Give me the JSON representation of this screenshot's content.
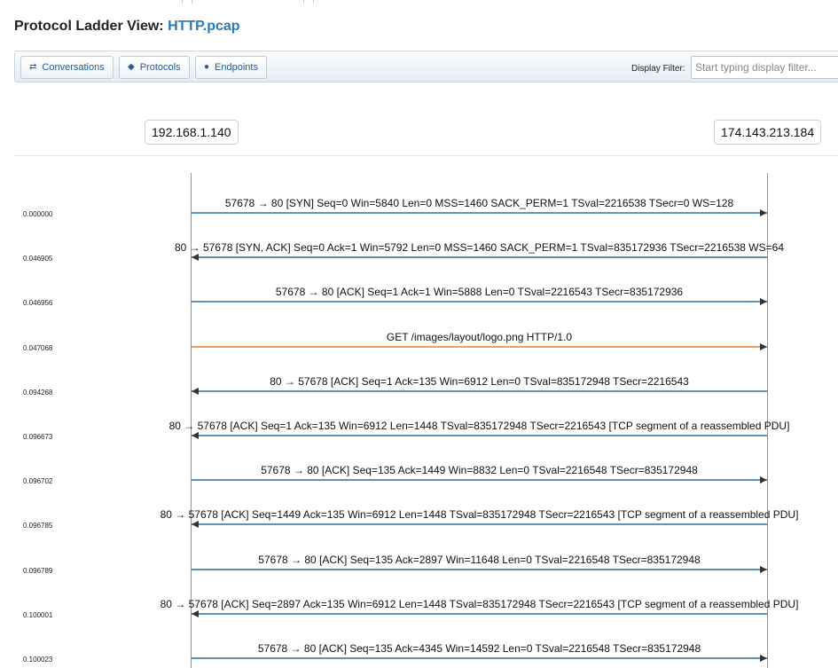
{
  "title": {
    "label": "Protocol Ladder View:",
    "file": "HTTP.pcap"
  },
  "toolbar": {
    "buttons": [
      {
        "icon": "arrows-exchange-icon",
        "glyph": "⇄",
        "label": "Conversations"
      },
      {
        "icon": "tag-icon",
        "glyph": "◆",
        "label": "Protocols"
      },
      {
        "icon": "dot-icon",
        "glyph": "●",
        "label": "Endpoints"
      }
    ],
    "filter_label": "Display Filter:",
    "filter_placeholder": "Start typing display filter..."
  },
  "hosts": {
    "left": "192.168.1.140",
    "right": "174.143.213.184"
  },
  "colors": {
    "default_arrow": "#2e6da4",
    "http_arrow": "#f07d27",
    "lifeline": "#6e9ec9"
  },
  "packets": [
    {
      "time": "0.000000",
      "dir": "right",
      "http": false,
      "info": "57678 → 80 [SYN] Seq=0 Win=5840 Len=0 MSS=1460 SACK_PERM=1 TSval=2216538 TSecr=0 WS=128"
    },
    {
      "time": "0.046905",
      "dir": "left",
      "http": false,
      "info": "80 → 57678 [SYN, ACK] Seq=0 Ack=1 Win=5792 Len=0 MSS=1460 SACK_PERM=1 TSval=835172936 TSecr=2216538 WS=64"
    },
    {
      "time": "0.046956",
      "dir": "right",
      "http": false,
      "info": "57678 → 80 [ACK] Seq=1 Ack=1 Win=5888 Len=0 TSval=2216543 TSecr=835172936"
    },
    {
      "time": "0.047068",
      "dir": "right",
      "http": true,
      "info": "GET /images/layout/logo.png HTTP/1.0"
    },
    {
      "time": "0.094268",
      "dir": "left",
      "http": false,
      "info": "80 → 57678 [ACK] Seq=1 Ack=135 Win=6912 Len=0 TSval=835172948 TSecr=2216543"
    },
    {
      "time": "0.096673",
      "dir": "left",
      "http": false,
      "info": "80 → 57678 [ACK] Seq=1 Ack=135 Win=6912 Len=1448 TSval=835172948 TSecr=2216543 [TCP segment of a reassembled PDU]"
    },
    {
      "time": "0.096702",
      "dir": "right",
      "http": false,
      "info": "57678 → 80 [ACK] Seq=135 Ack=1449 Win=8832 Len=0 TSval=2216548 TSecr=835172948"
    },
    {
      "time": "0.096785",
      "dir": "left",
      "http": false,
      "info": "80 → 57678 [ACK] Seq=1449 Ack=135 Win=6912 Len=1448 TSval=835172948 TSecr=2216543 [TCP segment of a reassembled PDU]"
    },
    {
      "time": "0.096789",
      "dir": "right",
      "http": false,
      "info": "57678 → 80 [ACK] Seq=135 Ack=2897 Win=11648 Len=0 TSval=2216548 TSecr=835172948"
    },
    {
      "time": "0.100001",
      "dir": "left",
      "http": false,
      "info": "80 → 57678 [ACK] Seq=2897 Ack=135 Win=6912 Len=1448 TSval=835172948 TSecr=2216543 [TCP segment of a reassembled PDU]"
    },
    {
      "time": "0.100023",
      "dir": "right",
      "http": false,
      "info": "57678 → 80 [ACK] Seq=135 Ack=4345 Win=14592 Len=0 TSval=2216548 TSecr=835172948"
    }
  ]
}
